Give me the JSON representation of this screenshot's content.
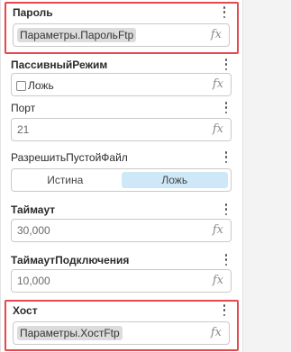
{
  "properties": [
    {
      "label": "Пароль",
      "value": "Параметры.ПарольFtp",
      "fx": "fx"
    },
    {
      "label": "ПассивныйРежим",
      "checkbox_label": "Ложь",
      "fx": "fx"
    },
    {
      "label": "Порт",
      "value": "21",
      "fx": "fx"
    },
    {
      "label": "РазрешитьПустойФайл",
      "options": [
        "Истина",
        "Ложь"
      ],
      "selected": "Ложь"
    },
    {
      "label": "Таймаут",
      "value": "30,000",
      "fx": "fx"
    },
    {
      "label": "ТаймаутПодключения",
      "value": "10,000",
      "fx": "fx"
    },
    {
      "label": "Хост",
      "value": "Параметры.ХостFtp",
      "fx": "fx"
    }
  ]
}
